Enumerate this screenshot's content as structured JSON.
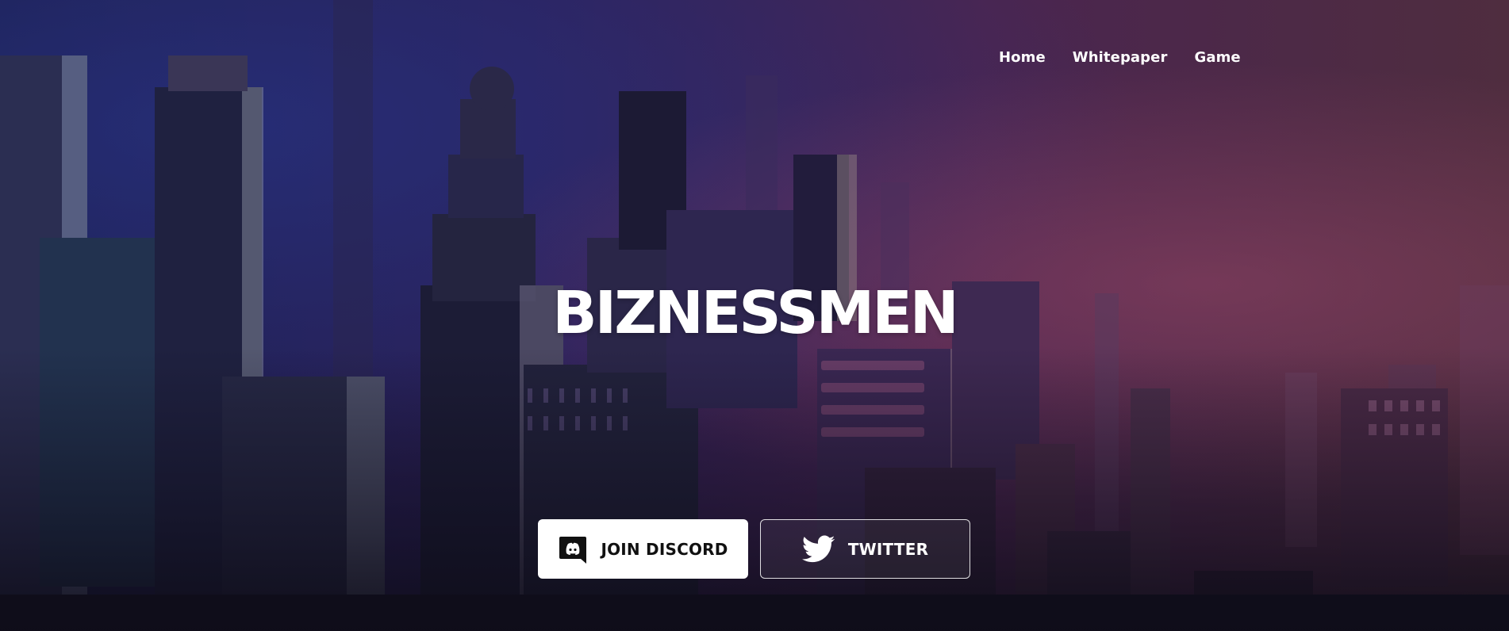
{
  "nav": {
    "items": [
      {
        "label": "Home"
      },
      {
        "label": "Whitepaper"
      },
      {
        "label": "Game"
      }
    ]
  },
  "hero": {
    "title": "BIZNESSMEN"
  },
  "buttons": {
    "discord": {
      "label": "JOIN DISCORD",
      "icon": "discord-icon"
    },
    "twitter": {
      "label": "TWITTER",
      "icon": "twitter-bird-icon"
    }
  },
  "colors": {
    "text": "#ffffff",
    "primary_button_bg": "#ffffff",
    "primary_button_text": "#111111"
  }
}
